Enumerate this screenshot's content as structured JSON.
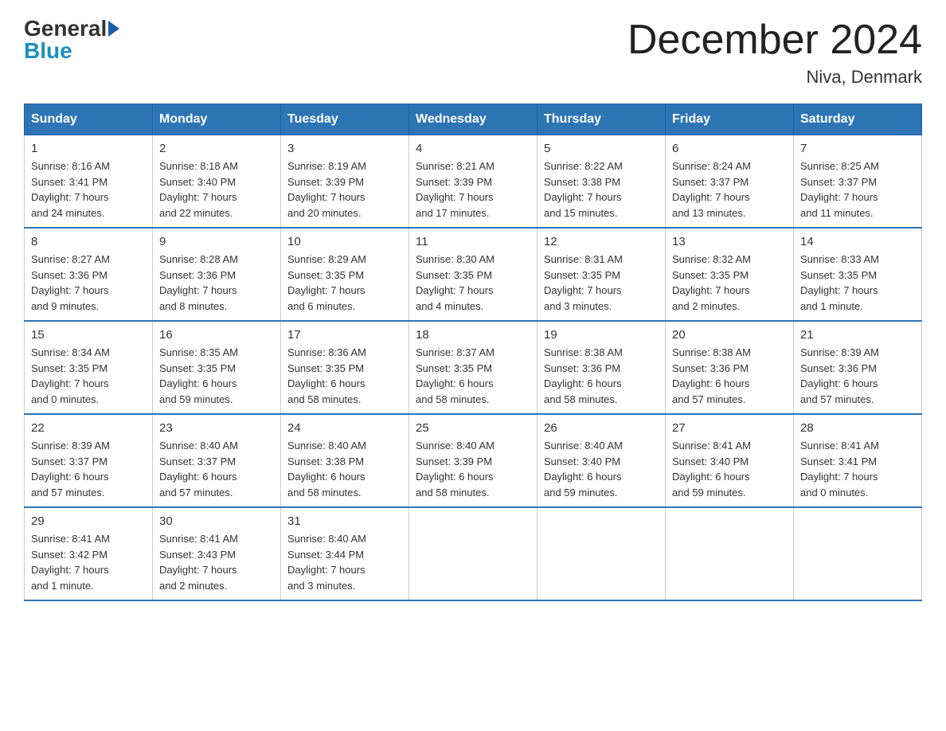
{
  "header": {
    "logo": {
      "general": "General",
      "blue": "Blue"
    },
    "title": "December 2024",
    "location": "Niva, Denmark"
  },
  "weekdays": [
    "Sunday",
    "Monday",
    "Tuesday",
    "Wednesday",
    "Thursday",
    "Friday",
    "Saturday"
  ],
  "weeks": [
    [
      {
        "day": "1",
        "sunrise": "8:16 AM",
        "sunset": "3:41 PM",
        "daylight": "7 hours and 24 minutes."
      },
      {
        "day": "2",
        "sunrise": "8:18 AM",
        "sunset": "3:40 PM",
        "daylight": "7 hours and 22 minutes."
      },
      {
        "day": "3",
        "sunrise": "8:19 AM",
        "sunset": "3:39 PM",
        "daylight": "7 hours and 20 minutes."
      },
      {
        "day": "4",
        "sunrise": "8:21 AM",
        "sunset": "3:39 PM",
        "daylight": "7 hours and 17 minutes."
      },
      {
        "day": "5",
        "sunrise": "8:22 AM",
        "sunset": "3:38 PM",
        "daylight": "7 hours and 15 minutes."
      },
      {
        "day": "6",
        "sunrise": "8:24 AM",
        "sunset": "3:37 PM",
        "daylight": "7 hours and 13 minutes."
      },
      {
        "day": "7",
        "sunrise": "8:25 AM",
        "sunset": "3:37 PM",
        "daylight": "7 hours and 11 minutes."
      }
    ],
    [
      {
        "day": "8",
        "sunrise": "8:27 AM",
        "sunset": "3:36 PM",
        "daylight": "7 hours and 9 minutes."
      },
      {
        "day": "9",
        "sunrise": "8:28 AM",
        "sunset": "3:36 PM",
        "daylight": "7 hours and 8 minutes."
      },
      {
        "day": "10",
        "sunrise": "8:29 AM",
        "sunset": "3:35 PM",
        "daylight": "7 hours and 6 minutes."
      },
      {
        "day": "11",
        "sunrise": "8:30 AM",
        "sunset": "3:35 PM",
        "daylight": "7 hours and 4 minutes."
      },
      {
        "day": "12",
        "sunrise": "8:31 AM",
        "sunset": "3:35 PM",
        "daylight": "7 hours and 3 minutes."
      },
      {
        "day": "13",
        "sunrise": "8:32 AM",
        "sunset": "3:35 PM",
        "daylight": "7 hours and 2 minutes."
      },
      {
        "day": "14",
        "sunrise": "8:33 AM",
        "sunset": "3:35 PM",
        "daylight": "7 hours and 1 minute."
      }
    ],
    [
      {
        "day": "15",
        "sunrise": "8:34 AM",
        "sunset": "3:35 PM",
        "daylight": "7 hours and 0 minutes."
      },
      {
        "day": "16",
        "sunrise": "8:35 AM",
        "sunset": "3:35 PM",
        "daylight": "6 hours and 59 minutes."
      },
      {
        "day": "17",
        "sunrise": "8:36 AM",
        "sunset": "3:35 PM",
        "daylight": "6 hours and 58 minutes."
      },
      {
        "day": "18",
        "sunrise": "8:37 AM",
        "sunset": "3:35 PM",
        "daylight": "6 hours and 58 minutes."
      },
      {
        "day": "19",
        "sunrise": "8:38 AM",
        "sunset": "3:36 PM",
        "daylight": "6 hours and 58 minutes."
      },
      {
        "day": "20",
        "sunrise": "8:38 AM",
        "sunset": "3:36 PM",
        "daylight": "6 hours and 57 minutes."
      },
      {
        "day": "21",
        "sunrise": "8:39 AM",
        "sunset": "3:36 PM",
        "daylight": "6 hours and 57 minutes."
      }
    ],
    [
      {
        "day": "22",
        "sunrise": "8:39 AM",
        "sunset": "3:37 PM",
        "daylight": "6 hours and 57 minutes."
      },
      {
        "day": "23",
        "sunrise": "8:40 AM",
        "sunset": "3:37 PM",
        "daylight": "6 hours and 57 minutes."
      },
      {
        "day": "24",
        "sunrise": "8:40 AM",
        "sunset": "3:38 PM",
        "daylight": "6 hours and 58 minutes."
      },
      {
        "day": "25",
        "sunrise": "8:40 AM",
        "sunset": "3:39 PM",
        "daylight": "6 hours and 58 minutes."
      },
      {
        "day": "26",
        "sunrise": "8:40 AM",
        "sunset": "3:40 PM",
        "daylight": "6 hours and 59 minutes."
      },
      {
        "day": "27",
        "sunrise": "8:41 AM",
        "sunset": "3:40 PM",
        "daylight": "6 hours and 59 minutes."
      },
      {
        "day": "28",
        "sunrise": "8:41 AM",
        "sunset": "3:41 PM",
        "daylight": "7 hours and 0 minutes."
      }
    ],
    [
      {
        "day": "29",
        "sunrise": "8:41 AM",
        "sunset": "3:42 PM",
        "daylight": "7 hours and 1 minute."
      },
      {
        "day": "30",
        "sunrise": "8:41 AM",
        "sunset": "3:43 PM",
        "daylight": "7 hours and 2 minutes."
      },
      {
        "day": "31",
        "sunrise": "8:40 AM",
        "sunset": "3:44 PM",
        "daylight": "7 hours and 3 minutes."
      },
      null,
      null,
      null,
      null
    ]
  ]
}
